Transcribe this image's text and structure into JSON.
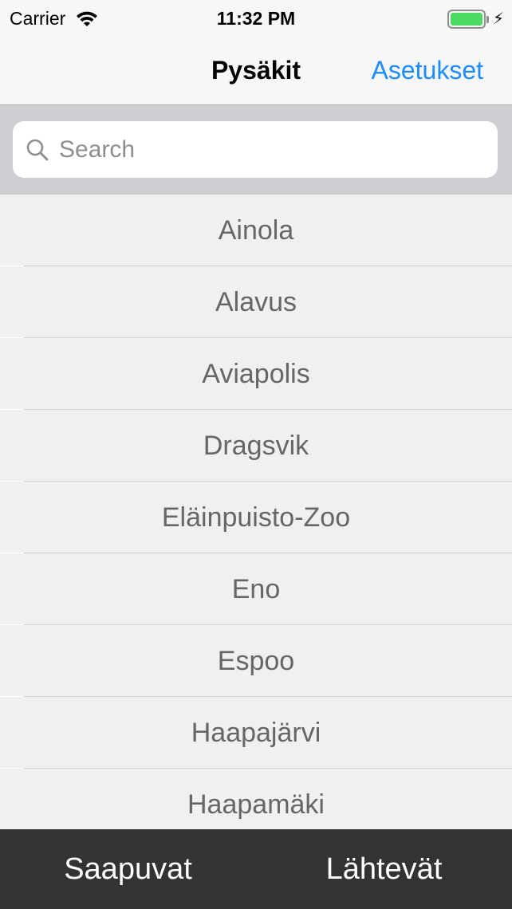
{
  "status_bar": {
    "carrier": "Carrier",
    "time": "11:32 PM",
    "battery_level": 1.0,
    "charging": true,
    "battery_color": "#4cd964"
  },
  "nav": {
    "title": "Pysäkit",
    "settings_label": "Asetukset",
    "accent_color": "#1a8cff"
  },
  "search": {
    "placeholder": "Search",
    "value": "",
    "icon": "search-icon"
  },
  "stops": [
    "Ainola",
    "Alavus",
    "Aviapolis",
    "Dragsvik",
    "Eläinpuisto-Zoo",
    "Eno",
    "Espoo",
    "Haapajärvi",
    "Haapamäki"
  ],
  "bottom_tabs": {
    "arrivals": "Saapuvat",
    "departures": "Lähtevät"
  }
}
